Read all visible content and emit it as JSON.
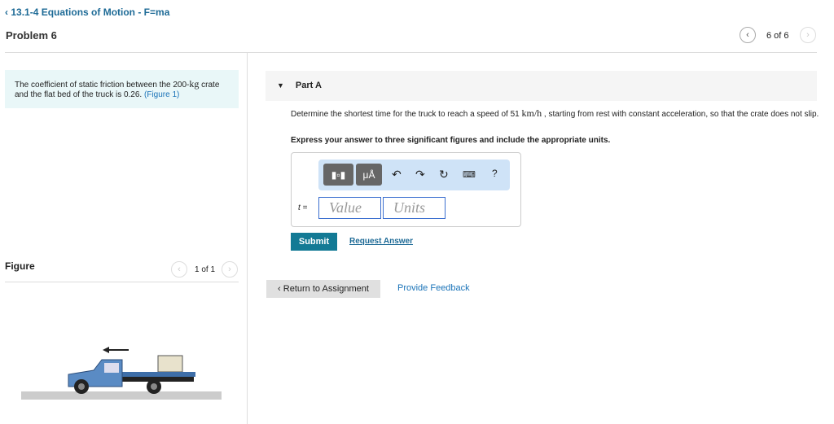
{
  "header": {
    "breadcrumb": "13.1-4 Equations of Motion - F=ma",
    "title": "Problem 6",
    "page": "6 of 6"
  },
  "problem": {
    "text_before": "The coefficient of static friction between the 200-",
    "unit": "kg",
    "text_after": " crate and the flat bed of the truck is 0.26. ",
    "figure_link": "(Figure 1)"
  },
  "figure": {
    "label": "Figure",
    "page": "1 of 1"
  },
  "part": {
    "title": "Part A",
    "question_before": "Determine the shortest time for the truck to reach a speed of 51 ",
    "question_unit": "km/h",
    "question_after": " , starting from rest with constant acceleration, so that the crate does not slip.",
    "instruction": "Express your answer to three significant figures and include the appropriate units.",
    "var_label": "t =",
    "value_placeholder": "Value",
    "units_placeholder": "Units",
    "symbols_label": "μÅ",
    "help_label": "?"
  },
  "actions": {
    "submit": "Submit",
    "request_answer": "Request Answer",
    "return": "Return to Assignment",
    "feedback": "Provide Feedback"
  }
}
